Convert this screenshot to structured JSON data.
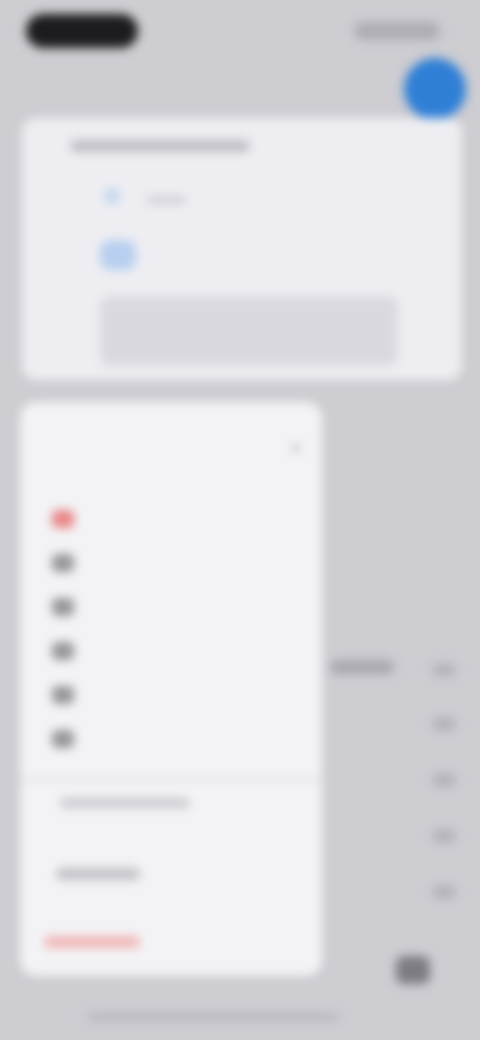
{
  "top_bar": {
    "title": ""
  },
  "context_menu": {
    "header": "",
    "items": [
      {
        "label": "",
        "icon": ""
      },
      {
        "label": "",
        "icon": "pin-icon"
      },
      {
        "label": "",
        "icon": "edit-icon"
      },
      {
        "label": "",
        "icon": "folder-icon"
      },
      {
        "label": "",
        "icon": "share-icon"
      },
      {
        "label": "",
        "icon": "info-icon"
      }
    ]
  }
}
